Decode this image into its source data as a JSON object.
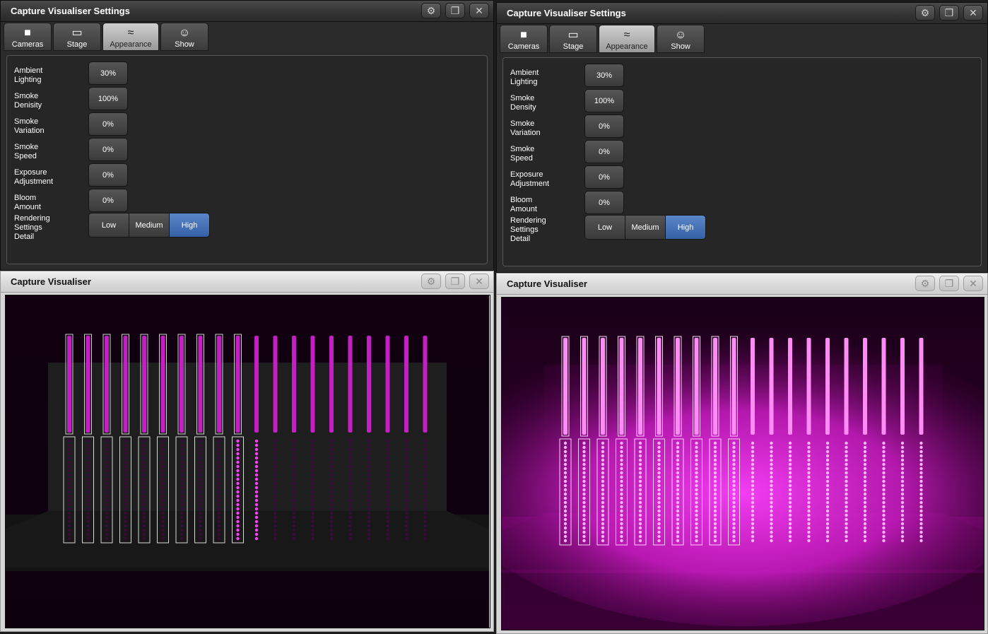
{
  "settings_windows": [
    {
      "title": "Capture Visualiser Settings",
      "tabs": [
        {
          "label": "Cameras",
          "icon": "camera-icon",
          "active": false
        },
        {
          "label": "Stage",
          "icon": "stage-icon",
          "active": false
        },
        {
          "label": "Appearance",
          "icon": "waves-icon",
          "active": true
        },
        {
          "label": "Show",
          "icon": "masks-icon",
          "active": false
        }
      ],
      "fields": [
        {
          "label": "Ambient\nLighting",
          "value": "30%"
        },
        {
          "label": "Smoke\nDenisity",
          "value": "100%"
        },
        {
          "label": "Smoke\nVariation",
          "value": "0%"
        },
        {
          "label": "Smoke\nSpeed",
          "value": "0%"
        },
        {
          "label": "Exposure\nAdjustment",
          "value": "0%"
        },
        {
          "label": "Bloom\nAmount",
          "value": "0%"
        }
      ],
      "rendering": {
        "label": "Rendering\nSettings\nDetail",
        "options": [
          "Low",
          "Medium",
          "High"
        ],
        "selected": "High"
      }
    },
    {
      "title": "Capture Visualiser Settings",
      "tabs": [
        {
          "label": "Cameras",
          "icon": "camera-icon",
          "active": false
        },
        {
          "label": "Stage",
          "icon": "stage-icon",
          "active": false
        },
        {
          "label": "Appearance",
          "icon": "waves-icon",
          "active": true
        },
        {
          "label": "Show",
          "icon": "masks-icon",
          "active": false
        }
      ],
      "fields": [
        {
          "label": "Ambient\nLighting",
          "value": "30%"
        },
        {
          "label": "Smoke\nDensity",
          "value": "100%"
        },
        {
          "label": "Smoke\nVariation",
          "value": "0%"
        },
        {
          "label": "Smoke\nSpeed",
          "value": "0%"
        },
        {
          "label": "Exposure\nAdjustment",
          "value": "0%"
        },
        {
          "label": "Bloom\nAmount",
          "value": "0%"
        }
      ],
      "rendering": {
        "label": "Rendering\nSettings\nDetail",
        "options": [
          "Low",
          "Medium",
          "High"
        ],
        "selected": "High"
      }
    }
  ],
  "visualiser_windows": [
    {
      "title": "Capture Visualiser",
      "scene": "clear"
    },
    {
      "title": "Capture Visualiser",
      "scene": "smoky"
    }
  ],
  "window_buttons": {
    "settings": "gear-icon",
    "restore": "restore-icon",
    "close": "close-icon"
  },
  "colors": {
    "accent_selected": "#3d68ae",
    "fixture_magenta": "#e62ee6"
  },
  "stage": {
    "fixture_count": 20,
    "selected_fixtures": 10
  }
}
